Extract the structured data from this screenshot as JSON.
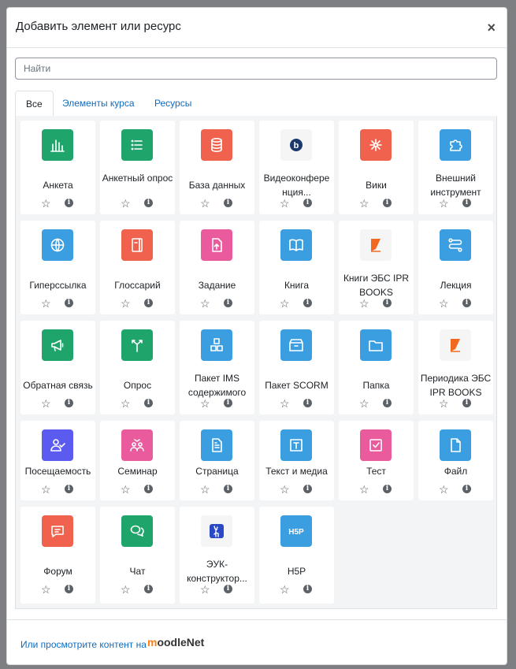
{
  "dialog": {
    "title": "Добавить элемент или ресурс",
    "close": "×"
  },
  "search": {
    "placeholder": "Найти",
    "value": ""
  },
  "tabs": [
    {
      "label": "Все",
      "active": true
    },
    {
      "label": "Элементы курса",
      "active": false
    },
    {
      "label": "Ресурсы",
      "active": false
    }
  ],
  "actions": {
    "star": "☆",
    "info": "i"
  },
  "items": [
    {
      "label": "Анкета",
      "icon": "bar-chart-icon",
      "color": "#1fa56b"
    },
    {
      "label": "Анкетный опрос",
      "icon": "list-icon",
      "color": "#1fa56b"
    },
    {
      "label": "База данных",
      "icon": "database-icon",
      "color": "#f0624d"
    },
    {
      "label": "Видеоконфере нция...",
      "icon": "bigbluebutton-icon",
      "color": "#f5f5f5"
    },
    {
      "label": "Вики",
      "icon": "wiki-icon",
      "color": "#f0624d"
    },
    {
      "label": "Внешний инструмент",
      "icon": "puzzle-icon",
      "color": "#3a9ee0"
    },
    {
      "label": "Гиперссылка",
      "icon": "globe-icon",
      "color": "#3a9ee0"
    },
    {
      "label": "Глоссарий",
      "icon": "glossary-icon",
      "color": "#f0624d"
    },
    {
      "label": "Задание",
      "icon": "assignment-icon",
      "color": "#ea5b9d"
    },
    {
      "label": "Книга",
      "icon": "book-icon",
      "color": "#3a9ee0"
    },
    {
      "label": "Книги ЭБС IPR BOOKS",
      "icon": "ipr-books-icon",
      "color": "#f5f5f5"
    },
    {
      "label": "Лекция",
      "icon": "lesson-icon",
      "color": "#3a9ee0"
    },
    {
      "label": "Обратная связь",
      "icon": "megaphone-icon",
      "color": "#1fa56b"
    },
    {
      "label": "Опрос",
      "icon": "choice-icon",
      "color": "#1fa56b"
    },
    {
      "label": "Пакет IMS содержимого",
      "icon": "ims-package-icon",
      "color": "#3a9ee0"
    },
    {
      "label": "Пакет SCORM",
      "icon": "scorm-box-icon",
      "color": "#3a9ee0"
    },
    {
      "label": "Папка",
      "icon": "folder-icon",
      "color": "#3a9ee0"
    },
    {
      "label": "Периодика ЭБС IPR BOOKS",
      "icon": "ipr-periodic-icon",
      "color": "#f5f5f5"
    },
    {
      "label": "Посещаемость",
      "icon": "attendance-icon",
      "color": "#5b5bf0"
    },
    {
      "label": "Семинар",
      "icon": "workshop-icon",
      "color": "#ea5b9d"
    },
    {
      "label": "Страница",
      "icon": "page-icon",
      "color": "#3a9ee0"
    },
    {
      "label": "Текст и медиа",
      "icon": "text-media-icon",
      "color": "#3a9ee0"
    },
    {
      "label": "Тест",
      "icon": "quiz-icon",
      "color": "#ea5b9d"
    },
    {
      "label": "Файл",
      "icon": "file-icon",
      "color": "#3a9ee0"
    },
    {
      "label": "Форум",
      "icon": "forum-icon",
      "color": "#f0624d"
    },
    {
      "label": "Чат",
      "icon": "chat-icon",
      "color": "#1fa56b"
    },
    {
      "label": "ЭУК-конструктор...",
      "icon": "deer-icon",
      "color": "#f5f5f5"
    },
    {
      "label": "H5P",
      "icon": "h5p-icon",
      "color": "#3a9ee0"
    }
  ],
  "footer": {
    "link": "Или просмотрите контент на",
    "brand_m": "m",
    "brand_rest": "oodleNet"
  }
}
